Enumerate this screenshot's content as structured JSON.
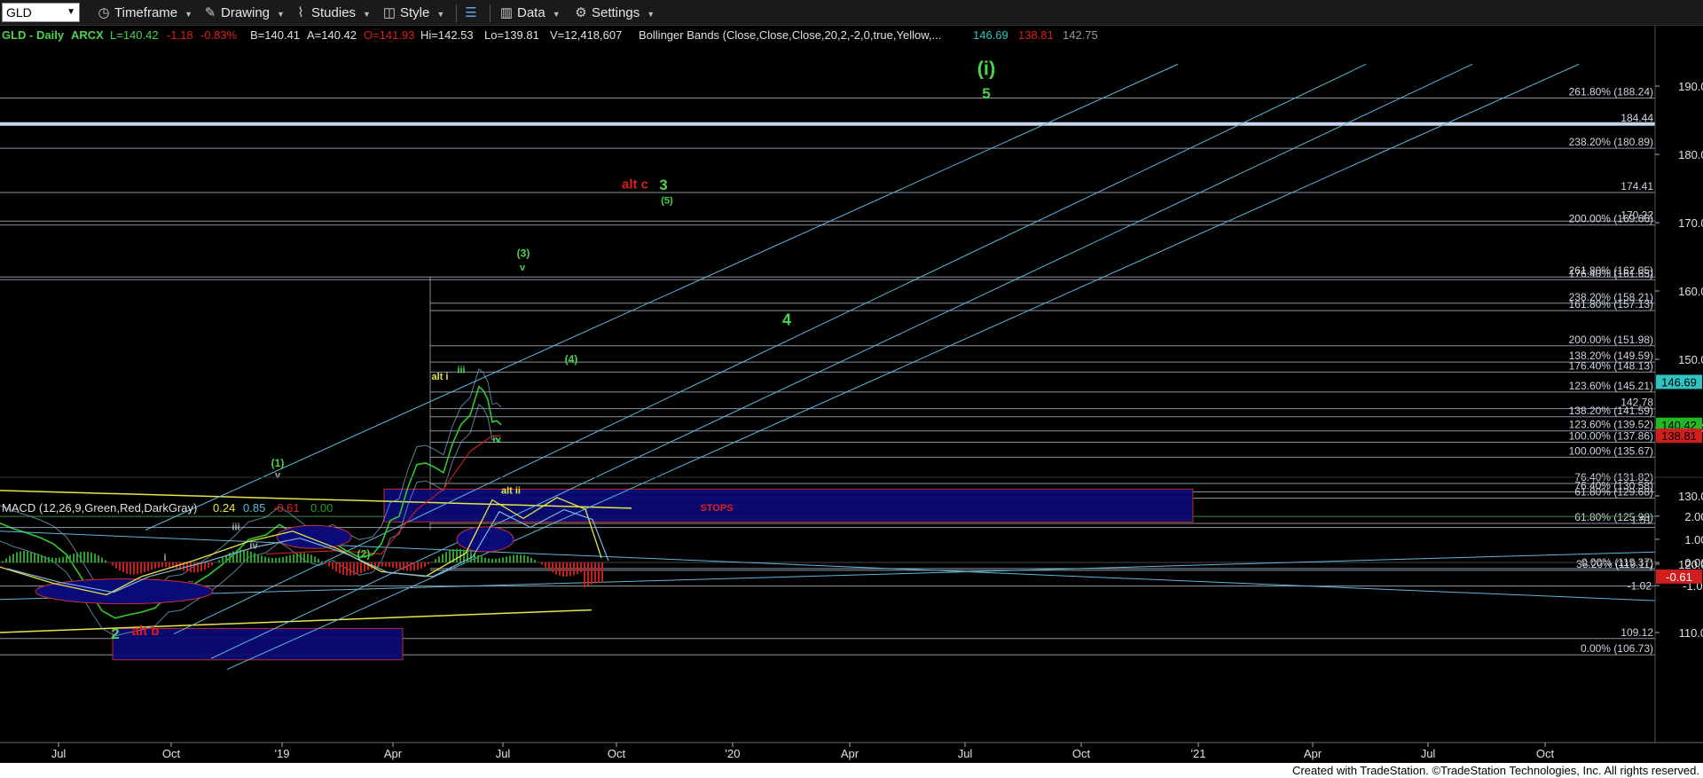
{
  "toolbar": {
    "symbol": "GLD",
    "timeframe": "Timeframe",
    "drawing": "Drawing",
    "studies": "Studies",
    "style": "Style",
    "data": "Data",
    "settings": "Settings"
  },
  "header": {
    "symbol_info": "GLD - Daily",
    "exchange": "ARCX",
    "last": "L=140.42",
    "change": "-1.18",
    "change_pct": "-0.83%",
    "bid": "B=140.41",
    "ask": "A=140.42",
    "open": "O=141.93",
    "high": "Hi=142.53",
    "low": "Lo=139.81",
    "volume": "V=12,418,607",
    "bollinger": "Bollinger Bands (Close,Close,Close,20,2,-2,0,true,Yellow,...",
    "bb_upper": "146.69",
    "bb_lower": "138.81",
    "bb_mid": "142.75"
  },
  "macd_header": {
    "label": "MACD (12,26,9,Green,Red,DarkGray)",
    "v1": "0.24",
    "v2": "0.85",
    "v3": "-0.61",
    "v4": "0.00"
  },
  "colors": {
    "background": "#000000",
    "fib_line": "#b7c4d6",
    "channel": "#5fb8d8",
    "box_fill": "#0a0a78",
    "box_border": "#c83232",
    "yellow": "#e6e64a",
    "wave_green": "#4cd24c",
    "wave_red": "#e01e1e",
    "price_green": "#2ecc2e",
    "macd_pos": "#2e9e2e",
    "macd_neg": "#c81e1e"
  },
  "chart_data": {
    "type": "line",
    "price_axis": {
      "ticks": [
        "190.00",
        "180.00",
        "170.00",
        "160.00",
        "150.00",
        "140.00",
        "130.00",
        "120.00",
        "110.00"
      ],
      "ylim": [
        104,
        197
      ]
    },
    "macd_axis": {
      "ticks": [
        "2.00",
        "1.00",
        "0.00",
        "-1.00"
      ],
      "ylim": [
        -1.5,
        3.0
      ]
    },
    "x_ticks": [
      "Jul",
      "Oct",
      "'19",
      "Apr",
      "Jul",
      "Oct",
      "'20",
      "Apr",
      "Jul",
      "Oct",
      "'21",
      "Apr",
      "Jul",
      "Oct"
    ],
    "price_series": {
      "name": "GLD",
      "values": [
        [
          0,
          126.0
        ],
        [
          15,
          125.2
        ],
        [
          30,
          124.6
        ],
        [
          45,
          123.9
        ],
        [
          60,
          123.0
        ],
        [
          75,
          121.4
        ],
        [
          90,
          118.4
        ],
        [
          105,
          115.2
        ],
        [
          115,
          113.2
        ],
        [
          130,
          112.1
        ],
        [
          145,
          112.6
        ],
        [
          160,
          113.0
        ],
        [
          175,
          113.6
        ],
        [
          190,
          115.6
        ],
        [
          205,
          115.9
        ],
        [
          220,
          117.2
        ],
        [
          235,
          118.4
        ],
        [
          250,
          119.9
        ],
        [
          265,
          121.6
        ],
        [
          280,
          123.6
        ],
        [
          300,
          124.3
        ],
        [
          315,
          125.8
        ],
        [
          325,
          125.0
        ],
        [
          345,
          123.0
        ],
        [
          360,
          122.4
        ],
        [
          375,
          123.2
        ],
        [
          390,
          122.0
        ],
        [
          405,
          121.0
        ],
        [
          420,
          121.4
        ],
        [
          430,
          123.0
        ],
        [
          440,
          126.4
        ],
        [
          450,
          127.0
        ],
        [
          460,
          131.3
        ],
        [
          470,
          134.6
        ],
        [
          480,
          134.8
        ],
        [
          490,
          134.2
        ],
        [
          500,
          133.4
        ],
        [
          510,
          137.6
        ],
        [
          520,
          140.5
        ],
        [
          530,
          141.8
        ],
        [
          540,
          146.0
        ],
        [
          545,
          145.4
        ],
        [
          550,
          144.1
        ],
        [
          555,
          140.8
        ],
        [
          560,
          141.0
        ],
        [
          565,
          140.4
        ]
      ]
    },
    "annotations_price": [
      {
        "text": "(i)",
        "x": 1112,
        "price": 191.6,
        "color": "#4cd24c",
        "size": 22
      },
      {
        "text": "5",
        "x": 1112,
        "price": 188.2,
        "color": "#4cd24c",
        "size": 17
      },
      {
        "text": "alt c",
        "x": 716,
        "price": 175.0,
        "color": "#e01e1e",
        "size": 15
      },
      {
        "text": "3",
        "x": 748,
        "price": 174.8,
        "color": "#4cd24c",
        "size": 17
      },
      {
        "text": "(5)",
        "x": 752,
        "price": 172.8,
        "color": "#4cd24c",
        "size": 11
      },
      {
        "text": "(3)",
        "x": 590,
        "price": 165.0,
        "color": "#4cd24c",
        "size": 12
      },
      {
        "text": "v",
        "x": 589,
        "price": 163.0,
        "color": "#4cd24c",
        "size": 11
      },
      {
        "text": "4",
        "x": 887,
        "price": 155.0,
        "color": "#4cd24c",
        "size": 18
      },
      {
        "text": "(4)",
        "x": 644,
        "price": 149.5,
        "color": "#4cd24c",
        "size": 12
      },
      {
        "text": "alt i",
        "x": 496,
        "price": 147.0,
        "color": "#e6e64a",
        "size": 11
      },
      {
        "text": "iii",
        "x": 520,
        "price": 148.0,
        "color": "#4cd24c",
        "size": 11
      },
      {
        "text": "iv",
        "x": 560,
        "price": 137.8,
        "color": "#4cd24c",
        "size": 11
      },
      {
        "text": "(1)",
        "x": 313,
        "price": 134.3,
        "color": "#4cd24c",
        "size": 12
      },
      {
        "text": "v",
        "x": 313,
        "price": 132.6,
        "color": "#aaaaaa",
        "size": 11
      },
      {
        "text": "alt ii",
        "x": 576,
        "price": 130.3,
        "color": "#e6e64a",
        "size": 11
      },
      {
        "text": "STOPS",
        "x": 808,
        "price": 127.8,
        "color": "#e01e1e",
        "size": 11
      },
      {
        "text": "iii",
        "x": 266,
        "price": 125.0,
        "color": "#aaaaaa",
        "size": 11
      },
      {
        "text": "iv",
        "x": 286,
        "price": 122.3,
        "color": "#aaaaaa",
        "size": 11
      },
      {
        "text": "i",
        "x": 186,
        "price": 120.5,
        "color": "#aaaaaa",
        "size": 11
      },
      {
        "text": "(2)",
        "x": 410,
        "price": 121.0,
        "color": "#4cd24c",
        "size": 12
      },
      {
        "text": "ii",
        "x": 215,
        "price": 116.5,
        "color": "#aaaaaa",
        "size": 11
      },
      {
        "text": "2",
        "x": 130,
        "price": 109.1,
        "color": "#4cd24c",
        "size": 17
      },
      {
        "text": "alt b",
        "x": 164,
        "price": 109.6,
        "color": "#e01e1e",
        "size": 15
      }
    ],
    "fib_levels": [
      {
        "label": "261.80% (188.24)",
        "price": 188.24
      },
      {
        "label": "184.44",
        "price": 184.44
      },
      {
        "label": "238.20% (180.89)",
        "price": 180.89
      },
      {
        "label": "174.41",
        "price": 174.41
      },
      {
        "label": "170.22",
        "price": 170.22
      },
      {
        "label": "200.00% (169.66)",
        "price": 169.66
      },
      {
        "label": "261.80% (162.05)",
        "price": 162.05
      },
      {
        "label": "176.40% (161.65)",
        "price": 161.65
      },
      {
        "label": "238.20% (158.21)",
        "price": 158.21
      },
      {
        "label": "161.80% (157.13)",
        "price": 157.13
      },
      {
        "label": "200.00% (151.98)",
        "price": 151.98
      },
      {
        "label": "138.20% (149.59)",
        "price": 149.59
      },
      {
        "label": "176.40% (148.13)",
        "price": 148.13
      },
      {
        "label": "123.60% (145.21)",
        "price": 145.21
      },
      {
        "label": "142.78",
        "price": 142.78
      },
      {
        "label": "138.20% (141.59)",
        "price": 141.59
      },
      {
        "label": "123.60% (139.52)",
        "price": 139.52
      },
      {
        "label": "100.00% (137.86)",
        "price": 137.86
      },
      {
        "label": "100.00% (135.67)",
        "price": 135.67
      },
      {
        "label": "76.40% (131.82)",
        "price": 131.82
      },
      {
        "label": "76.40% (130.58)",
        "price": 130.58
      },
      {
        "label": "61.80% (129.68)",
        "price": 129.68
      },
      {
        "label": "61.80% (125.98)",
        "price": 125.98
      },
      {
        "label": "0.00% (119.37)",
        "price": 119.37
      },
      {
        "label": "38.20% (119.11)",
        "price": 119.11
      },
      {
        "label": "109.12",
        "price": 109.12
      },
      {
        "label": "0.00% (106.73)",
        "price": 106.73
      }
    ],
    "price_markers": [
      {
        "label": "146.69",
        "price": 146.69,
        "color": "#2fc4c4"
      },
      {
        "label": "140.42",
        "price": 140.42,
        "color": "#23b823"
      },
      {
        "label": "138.81",
        "price": 138.81,
        "color": "#d01e1e"
      }
    ],
    "macd": {
      "level_label": "1.51",
      "level_value": 1.51,
      "low_label": "-1.02",
      "low_value": -1.02,
      "last_label": "-0.61",
      "last_value": -0.61
    }
  },
  "footer": {
    "credit": "Created with TradeStation. ©TradeStation Technologies, Inc. All rights reserved."
  }
}
